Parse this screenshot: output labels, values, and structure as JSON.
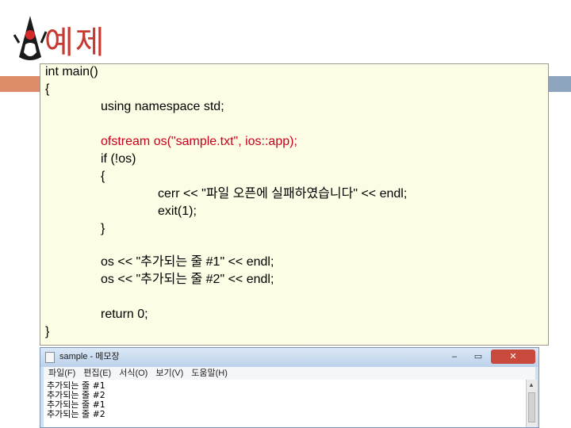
{
  "slide": {
    "title": "예제"
  },
  "colors": {
    "title": "#c53a32",
    "code_highlight": "#c8001e",
    "code_bg": "#fdfce4"
  },
  "code": {
    "lines": [
      "int main()",
      "{",
      "using namespace std;",
      "ofstream os(\"sample.txt\", ios::app);",
      "if (!os)",
      "{",
      "cerr << \"파일 오픈에 실패하였습니다\" << endl;",
      "exit(1);",
      "}",
      "os << \"추가되는 줄 #1\" << endl;",
      "os << \"추가되는 줄 #2\" << endl;",
      "return 0;",
      "}"
    ]
  },
  "notepad": {
    "title": "sample - 메모장",
    "icon": "notepad-icon",
    "window_buttons": {
      "minimize": "–",
      "maximize": "▭",
      "close": "✕"
    },
    "menu": [
      "파일(F)",
      "편집(E)",
      "서식(O)",
      "보기(V)",
      "도움말(H)"
    ],
    "content": [
      "추가되는 줄 #1",
      "추가되는 줄 #2",
      "추가되는 줄 #1",
      "추가되는 줄 #2"
    ]
  }
}
